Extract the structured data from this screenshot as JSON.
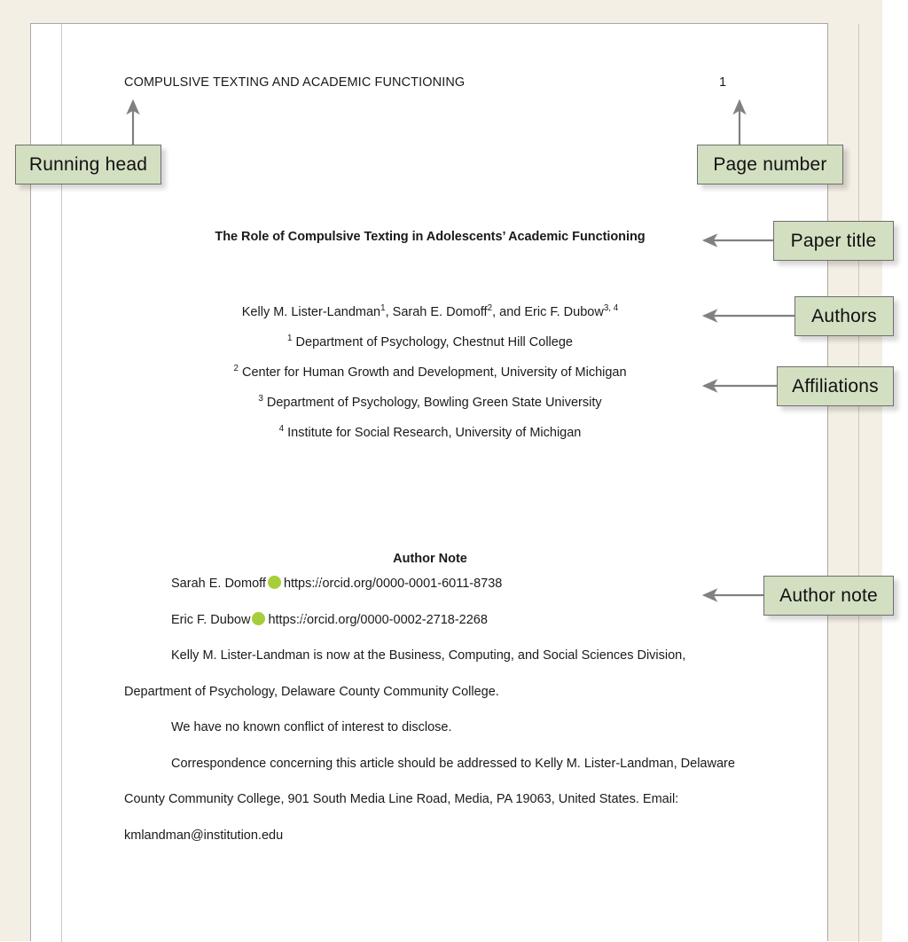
{
  "document": {
    "running_head": "COMPULSIVE TEXTING AND ACADEMIC FUNCTIONING",
    "page_number": "1",
    "title": "The Role of Compulsive Texting in Adolescents’ Academic Functioning",
    "authors": {
      "a1_name": "Kelly M. Lister-Landman",
      "a1_sup": "1",
      "sep1": ", ",
      "a2_name": "Sarah E. Domoff",
      "a2_sup": "2",
      "sep2": ", and ",
      "a3_name": "Eric F. Dubow",
      "a3_sup": "3, 4"
    },
    "affiliations": [
      {
        "marker": "1",
        "text": " Department of Psychology, Chestnut Hill College"
      },
      {
        "marker": "2",
        "text": " Center for Human Growth and Development, University of Michigan"
      },
      {
        "marker": "3",
        "text": " Department of Psychology, Bowling Green State University"
      },
      {
        "marker": "4",
        "text": " Institute for Social Research, University of Michigan"
      }
    ],
    "author_note": {
      "heading": "Author Note",
      "orcid_1_name": "Sarah E. Domoff",
      "orcid_1_url": "https://orcid.org/0000-0001-6011-8738",
      "orcid_2_name": "Eric F. Dubow",
      "orcid_2_url": "https://orcid.org/0000-0002-2718-2268",
      "orcid_icon_label": "iD",
      "para_affiliation_change": "Kelly M. Lister-Landman is now at the Business, Computing, and Social Sciences Division, Department of Psychology, Delaware County Community College.",
      "para_conflict": "We have no known conflict of interest to disclose.",
      "para_correspondence": "Correspondence concerning this article should be addressed to Kelly M. Lister-Landman, Delaware County Community College, 901 South Media Line Road, Media, PA 19063, United States. Email: kmlandman@institution.edu"
    }
  },
  "callouts": {
    "running_head": "Running head",
    "page_number": "Page number",
    "paper_title": "Paper title",
    "authors": "Authors",
    "affiliations": "Affiliations",
    "author_note": "Author note"
  },
  "colors": {
    "callout_fill": "#d3dfc1",
    "callout_border": "#6e6e6e",
    "arrow": "#808080",
    "backdrop": "#f4efe5",
    "page": "#ffffff",
    "orcid_green": "#a6ce39"
  }
}
